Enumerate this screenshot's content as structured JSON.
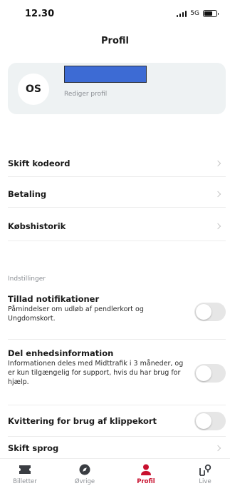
{
  "status_bar": {
    "time": "12.30",
    "network": "5G"
  },
  "header": {
    "title": "Profil"
  },
  "profile": {
    "initials": "OS",
    "edit_label": "Rediger profil"
  },
  "menu": [
    {
      "label": "Skift kodeord"
    },
    {
      "label": "Betaling"
    },
    {
      "label": "Købshistorik"
    }
  ],
  "settings": {
    "section_title": "Indstillinger",
    "items": [
      {
        "title": "Tillad notifikationer",
        "description": "Påmindelser om udløb af pendlerkort og Ungdomskort.",
        "enabled": false
      },
      {
        "title": "Del enhedsinformation",
        "description": "Informationen deles med Midttrafik i 3 måneder, og er kun tilgængelig for support, hvis du har brug for hjælp.",
        "enabled": false
      },
      {
        "title": "Kvittering for brug af klippekort",
        "description": "",
        "enabled": false
      }
    ],
    "language_label": "Skift sprog"
  },
  "tab_bar": {
    "tabs": [
      {
        "label": "Billetter",
        "icon": "ticket-icon"
      },
      {
        "label": "Øvrige",
        "icon": "compass-icon"
      },
      {
        "label": "Profil",
        "icon": "profile-icon",
        "active": true
      },
      {
        "label": "Live",
        "icon": "live-map-icon"
      }
    ]
  },
  "colors": {
    "accent": "#c8102e",
    "card_bg": "#eef2f3",
    "redaction": "#3d6bd4"
  }
}
